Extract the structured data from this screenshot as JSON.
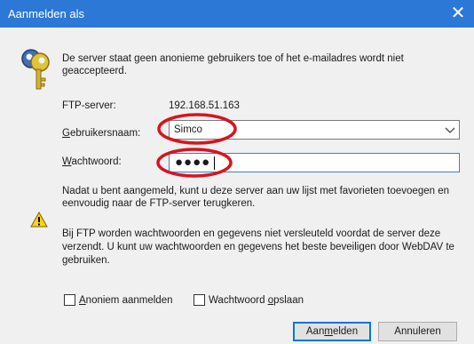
{
  "window": {
    "title": "Aanmelden als",
    "close_glyph": "✕"
  },
  "message": "De server staat geen anonieme gebruikers toe of het e-mailadres wordt niet geaccepteerd.",
  "ftp": {
    "label": "FTP-server:",
    "value": "192.168.51.163"
  },
  "username": {
    "label_accel": "G",
    "label_rest": "ebruikersnaam:",
    "value": "Simco"
  },
  "password": {
    "label_accel": "W",
    "label_rest": "achtwoord:",
    "value": "●●●●"
  },
  "info_favorites": "Nadat u bent aangemeld, kunt u deze server aan uw lijst met favorieten toevoegen en eenvoudig naar de FTP-server terugkeren.",
  "info_security": "Bij FTP worden wachtwoorden en gegevens niet versleuteld voordat de server deze verzendt. U kunt uw wachtwoorden en gegevens het beste beveiligen door WebDAV te gebruiken.",
  "options": {
    "anonymous": {
      "accel": "A",
      "rest": "noniem aanmelden",
      "checked": false
    },
    "save_password": {
      "before": "Wachtwoord ",
      "accel": "o",
      "after": "pslaan",
      "checked": false
    }
  },
  "buttons": {
    "login": {
      "before": "Aan",
      "accel": "m",
      "after": "elden"
    },
    "cancel": "Annuleren"
  },
  "colors": {
    "titlebar": "#2b78d6",
    "annotation": "#d7141e",
    "focus": "#0078d7"
  },
  "icons": {
    "keys": "keys-icon",
    "warning": "warning-icon",
    "dropdown": "chevron-down-icon"
  }
}
